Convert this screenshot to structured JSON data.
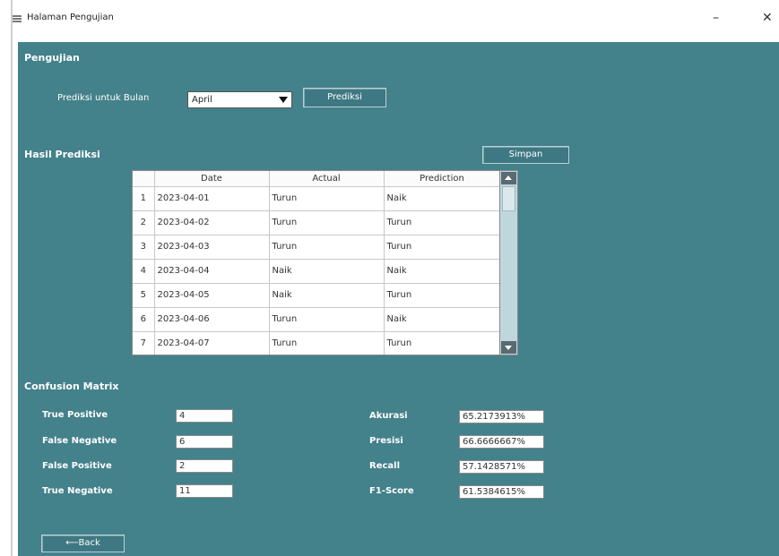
{
  "window": {
    "title": "Halaman Pengujian",
    "minimize_symbol": "–",
    "close_symbol": "✕"
  },
  "pengujian": {
    "section_title": "Pengujian",
    "predict_label": "Prediksi untuk Bulan",
    "month_value": "April",
    "predict_button": "Prediksi"
  },
  "hasil": {
    "section_title": "Hasil Prediksi",
    "save_button": "Simpan",
    "columns": [
      "",
      "Date",
      "Actual",
      "Prediction"
    ],
    "rows": [
      {
        "no": "1",
        "date": "2023-04-01",
        "actual": "Turun",
        "prediction": "Naik"
      },
      {
        "no": "2",
        "date": "2023-04-02",
        "actual": "Turun",
        "prediction": "Turun"
      },
      {
        "no": "3",
        "date": "2023-04-03",
        "actual": "Turun",
        "prediction": "Turun"
      },
      {
        "no": "4",
        "date": "2023-04-04",
        "actual": "Naik",
        "prediction": "Naik"
      },
      {
        "no": "5",
        "date": "2023-04-05",
        "actual": "Naik",
        "prediction": "Turun"
      },
      {
        "no": "6",
        "date": "2023-04-06",
        "actual": "Turun",
        "prediction": "Naik"
      },
      {
        "no": "7",
        "date": "2023-04-07",
        "actual": "Turun",
        "prediction": "Turun"
      }
    ]
  },
  "confusion": {
    "section_title": "Confusion Matrix",
    "true_positive_label": "True Positive",
    "true_positive": "4",
    "false_negative_label": "False Negative",
    "false_negative": "6",
    "false_positive_label": "False Positive",
    "false_positive": "2",
    "true_negative_label": "True Negative",
    "true_negative": "11",
    "accuracy_label": "Akurasi",
    "accuracy": "65.2173913%",
    "precision_label": "Presisi",
    "precision": "66.6666667%",
    "recall_label": "Recall",
    "recall": "57.1428571%",
    "f1_label": "F1-Score",
    "f1": "61.5384615%"
  },
  "footer": {
    "back_button": "Back"
  },
  "colors": {
    "panel": "#43818b",
    "button": "#3e7883"
  }
}
